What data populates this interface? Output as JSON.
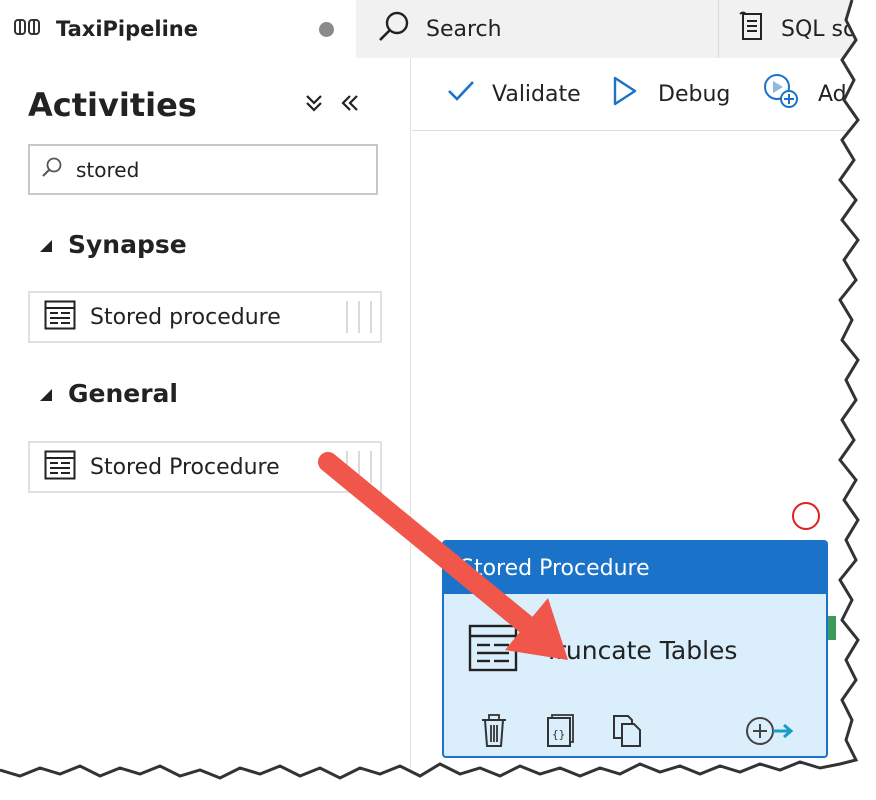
{
  "tabs": {
    "pipeline": {
      "title": "TaxiPipeline",
      "icon": "pipeline-icon"
    },
    "search": {
      "label": "Search",
      "icon": "search-icon"
    },
    "sql": {
      "label": "SQL sc",
      "icon": "sql-script-icon"
    }
  },
  "activities_panel": {
    "title": "Activities",
    "collapse_all_icon": "double-chevron-down-icon",
    "collapse_panel_icon": "double-chevron-left-icon",
    "search": {
      "value": "stored",
      "icon": "search-icon"
    },
    "sections": [
      {
        "name": "Synapse",
        "items": [
          {
            "label": "Stored procedure",
            "icon": "stored-procedure-icon"
          }
        ]
      },
      {
        "name": "General",
        "items": [
          {
            "label": "Stored Procedure",
            "icon": "stored-procedure-icon"
          }
        ]
      }
    ]
  },
  "toolbar": {
    "validate": "Validate",
    "debug": "Debug",
    "add_trigger": "Ad"
  },
  "node": {
    "type_label": "Stored Procedure",
    "name": "Truncate Tables",
    "actions": [
      "delete-icon",
      "code-icon",
      "copy-icon",
      "add-output-icon"
    ]
  },
  "colors": {
    "accent": "#1a73c8",
    "node_fill": "#dbeefc",
    "annotation_arrow": "#f0564a",
    "error_circle": "#e02020"
  }
}
